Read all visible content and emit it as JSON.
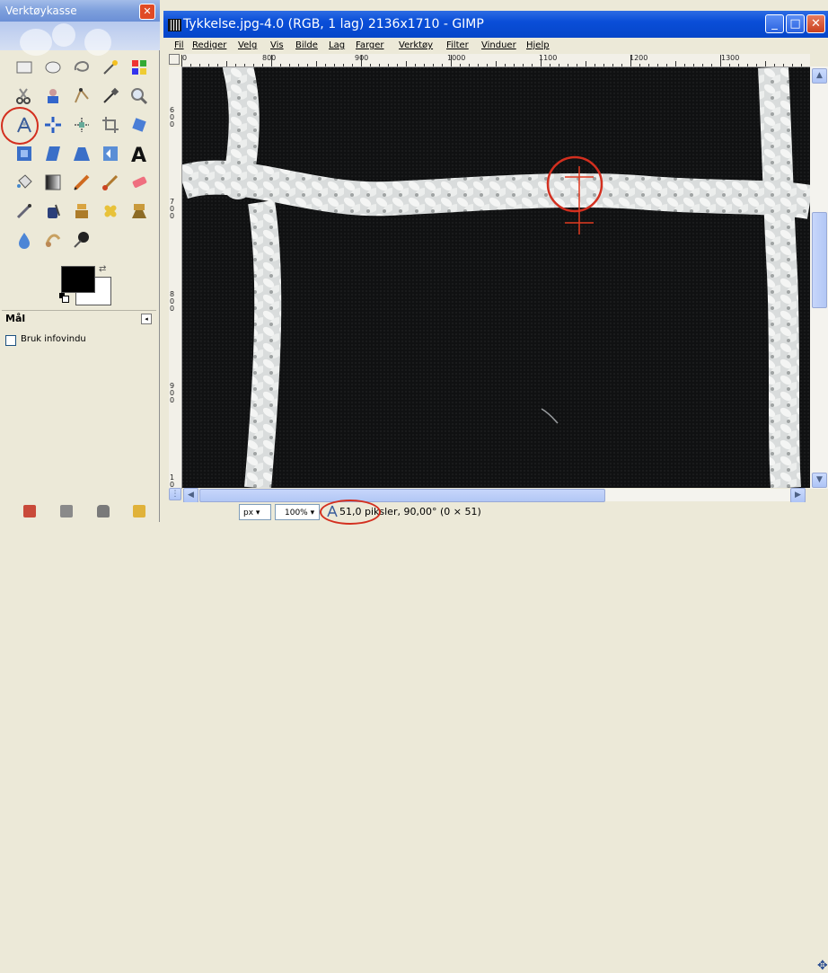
{
  "toolbox": {
    "title": "Verktøykasse",
    "close_label": "✕",
    "options": {
      "title": "Mål",
      "checkbox_label": "Bruk infovindu",
      "checked": false
    }
  },
  "image_window": {
    "title": "Tykkelse.jpg-4.0 (RGB, 1 lag) 2136x1710 - GIMP",
    "buttons": {
      "minimize": "_",
      "maximize": "□",
      "close": "✕"
    },
    "menus": [
      "Fil",
      "Rediger",
      "Velg",
      "Vis",
      "Bilde",
      "Lag",
      "Farger",
      "Verktøy",
      "Filter",
      "Vinduer",
      "Hjelp"
    ],
    "hruler_labels": [
      "0",
      "800",
      "900",
      "1000",
      "1100",
      "1200",
      "1300"
    ],
    "vruler_labels": [
      "6\n0\n0",
      "7\n0\n0",
      "8\n0\n0",
      "9\n0\n0",
      "1\n0"
    ],
    "status": {
      "unit": "px",
      "zoom": "100%",
      "measurement": "51,0 piksler, 90,00° (0 × 51)"
    }
  },
  "colors": {
    "annotation": "#d32f1f",
    "titlebar": "#0a4ed8",
    "canvas_bg": "#0e0f10"
  }
}
